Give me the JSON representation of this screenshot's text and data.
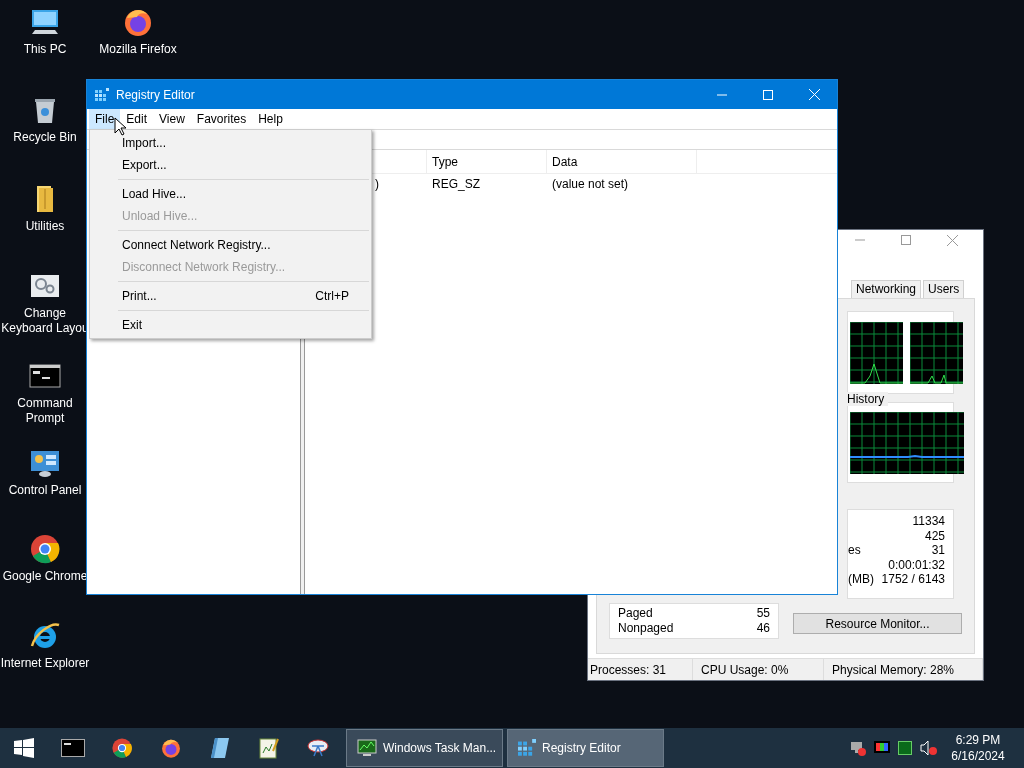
{
  "desktop_icons": [
    {
      "label": "This PC",
      "kind": "pc"
    },
    {
      "label": "Mozilla Firefox",
      "kind": "firefox"
    },
    {
      "label": "Recycle Bin",
      "kind": "recycle"
    },
    {
      "label": "Utilities",
      "kind": "folder"
    },
    {
      "label": "Change Keyboard Layou",
      "kind": "gears"
    },
    {
      "label": "Command Prompt",
      "kind": "cmd"
    },
    {
      "label": "Control Panel",
      "kind": "control"
    },
    {
      "label": "Google Chrome",
      "kind": "chrome"
    },
    {
      "label": "Internet Explorer",
      "kind": "ie"
    }
  ],
  "task_manager": {
    "tabs": [
      {
        "label": "Networking",
        "selected": false
      },
      {
        "label": "Users",
        "selected": false
      }
    ],
    "history_label": "History",
    "stats": [
      {
        "value": "11334"
      },
      {
        "value": "425"
      },
      {
        "label": "es",
        "value": "31"
      },
      {
        "value": "0:00:01:32"
      },
      {
        "label": "(MB)",
        "value": "1752 / 6143"
      }
    ],
    "kernel_memory": [
      {
        "label": "Paged",
        "value": "55"
      },
      {
        "label": "Nonpaged",
        "value": "46"
      }
    ],
    "button": "Resource Monitor...",
    "status_bar": [
      "Processes: 31",
      "CPU Usage: 0%",
      "Physical Memory: 28%"
    ]
  },
  "registry_editor": {
    "title": "Registry Editor",
    "menu": [
      {
        "label": "File",
        "selected": true
      },
      {
        "label": "Edit",
        "selected": false
      },
      {
        "label": "View",
        "selected": false
      },
      {
        "label": "Favorites",
        "selected": false
      },
      {
        "label": "Help",
        "selected": false
      }
    ],
    "file_menu": [
      {
        "kind": "item",
        "label": "Import...",
        "disabled": false
      },
      {
        "kind": "item",
        "label": "Export...",
        "disabled": false
      },
      {
        "kind": "separator"
      },
      {
        "kind": "item",
        "label": "Load Hive...",
        "disabled": false
      },
      {
        "kind": "item",
        "label": "Unload Hive...",
        "disabled": true
      },
      {
        "kind": "separator"
      },
      {
        "kind": "item",
        "label": "Connect Network Registry...",
        "disabled": false
      },
      {
        "kind": "item",
        "label": "Disconnect Network Registry...",
        "disabled": true
      },
      {
        "kind": "separator"
      },
      {
        "kind": "item",
        "label": "Print...",
        "shortcut": "Ctrl+P",
        "disabled": false
      },
      {
        "kind": "separator"
      },
      {
        "kind": "item",
        "label": "Exit",
        "disabled": false
      }
    ],
    "columns": [
      "Type",
      "Data"
    ],
    "rows": [
      {
        "name": ")",
        "type": "REG_SZ",
        "data": "(value not set)"
      }
    ]
  },
  "taskbar": {
    "tasks": [
      {
        "label": "Windows Task Man...",
        "kind": "taskmgr",
        "selected": false
      },
      {
        "label": "Registry Editor",
        "kind": "regedit",
        "selected": true
      }
    ],
    "time": "6:29 PM",
    "date": "6/16/2024"
  }
}
